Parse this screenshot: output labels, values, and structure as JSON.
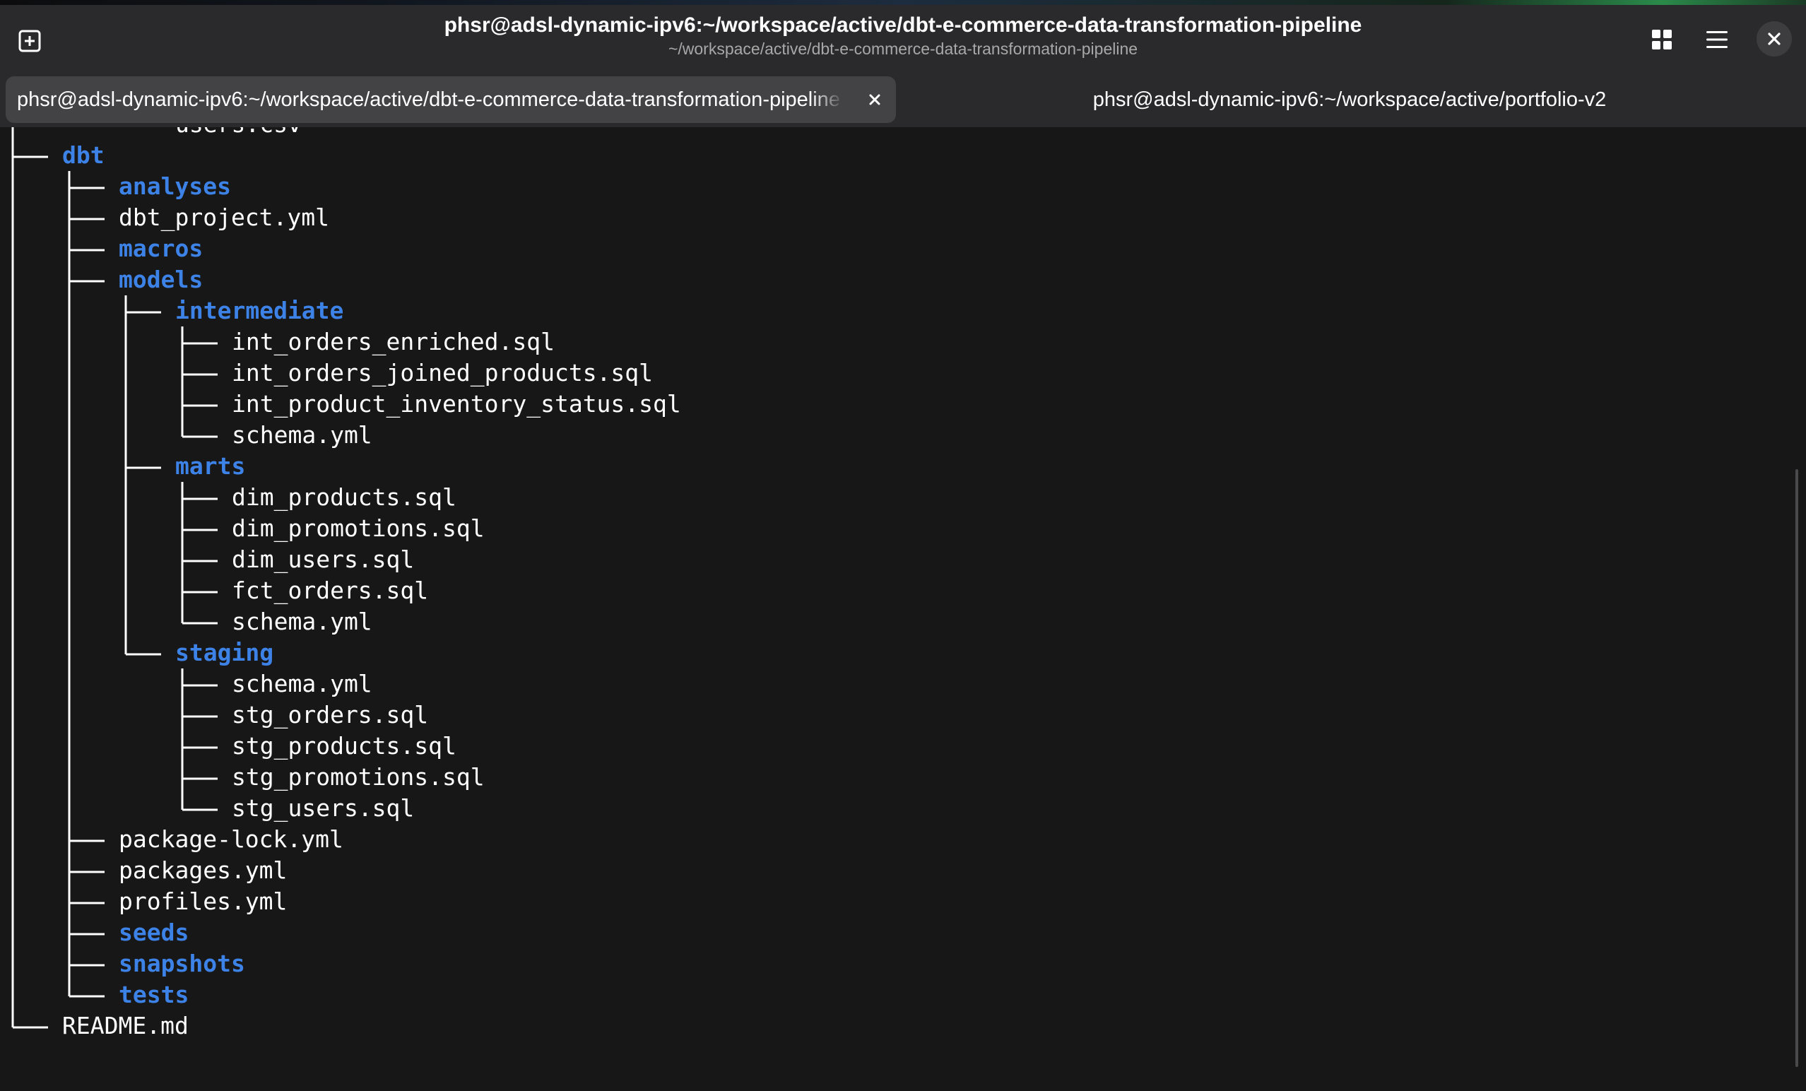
{
  "window": {
    "title": "phsr@adsl-dynamic-ipv6:~/workspace/active/dbt-e-commerce-data-transformation-pipeline",
    "subtitle": "~/workspace/active/dbt-e-commerce-data-transformation-pipeline",
    "icons": {
      "new_tab": "new-tab-icon",
      "overview": "grid-icon",
      "menu": "hamburger-menu-icon",
      "close": "close-icon"
    }
  },
  "tabs": [
    {
      "label": "phsr@adsl-dynamic-ipv6:~/workspace/active/dbt-e-commerce-data-transformation-pipeline",
      "active": true
    },
    {
      "label": "phsr@adsl-dynamic-ipv6:~/workspace/active/portfolio-v2",
      "active": false
    }
  ],
  "colors": {
    "directory": "#3d82e6",
    "file": "#ffffff",
    "background": "#171717",
    "headerbar": "#2a2a2c"
  },
  "tree": [
    {
      "name": "users.csv",
      "type": "file",
      "depth": 2,
      "last": true
    },
    {
      "name": "dbt",
      "type": "dir",
      "depth": 0,
      "last": false
    },
    {
      "name": "analyses",
      "type": "dir",
      "depth": 1,
      "last": false
    },
    {
      "name": "dbt_project.yml",
      "type": "file",
      "depth": 1,
      "last": false
    },
    {
      "name": "macros",
      "type": "dir",
      "depth": 1,
      "last": false
    },
    {
      "name": "models",
      "type": "dir",
      "depth": 1,
      "last": false
    },
    {
      "name": "intermediate",
      "type": "dir",
      "depth": 2,
      "last": false
    },
    {
      "name": "int_orders_enriched.sql",
      "type": "file",
      "depth": 3,
      "last": false
    },
    {
      "name": "int_orders_joined_products.sql",
      "type": "file",
      "depth": 3,
      "last": false
    },
    {
      "name": "int_product_inventory_status.sql",
      "type": "file",
      "depth": 3,
      "last": false
    },
    {
      "name": "schema.yml",
      "type": "file",
      "depth": 3,
      "last": true
    },
    {
      "name": "marts",
      "type": "dir",
      "depth": 2,
      "last": false
    },
    {
      "name": "dim_products.sql",
      "type": "file",
      "depth": 3,
      "last": false
    },
    {
      "name": "dim_promotions.sql",
      "type": "file",
      "depth": 3,
      "last": false
    },
    {
      "name": "dim_users.sql",
      "type": "file",
      "depth": 3,
      "last": false
    },
    {
      "name": "fct_orders.sql",
      "type": "file",
      "depth": 3,
      "last": false
    },
    {
      "name": "schema.yml",
      "type": "file",
      "depth": 3,
      "last": true
    },
    {
      "name": "staging",
      "type": "dir",
      "depth": 2,
      "last": true
    },
    {
      "name": "schema.yml",
      "type": "file",
      "depth": 3,
      "last": false
    },
    {
      "name": "stg_orders.sql",
      "type": "file",
      "depth": 3,
      "last": false
    },
    {
      "name": "stg_products.sql",
      "type": "file",
      "depth": 3,
      "last": false
    },
    {
      "name": "stg_promotions.sql",
      "type": "file",
      "depth": 3,
      "last": false
    },
    {
      "name": "stg_users.sql",
      "type": "file",
      "depth": 3,
      "last": true
    },
    {
      "name": "package-lock.yml",
      "type": "file",
      "depth": 1,
      "last": false
    },
    {
      "name": "packages.yml",
      "type": "file",
      "depth": 1,
      "last": false
    },
    {
      "name": "profiles.yml",
      "type": "file",
      "depth": 1,
      "last": false
    },
    {
      "name": "seeds",
      "type": "dir",
      "depth": 1,
      "last": false
    },
    {
      "name": "snapshots",
      "type": "dir",
      "depth": 1,
      "last": false
    },
    {
      "name": "tests",
      "type": "dir",
      "depth": 1,
      "last": true
    },
    {
      "name": "README.md",
      "type": "file",
      "depth": 0,
      "last": true
    }
  ]
}
